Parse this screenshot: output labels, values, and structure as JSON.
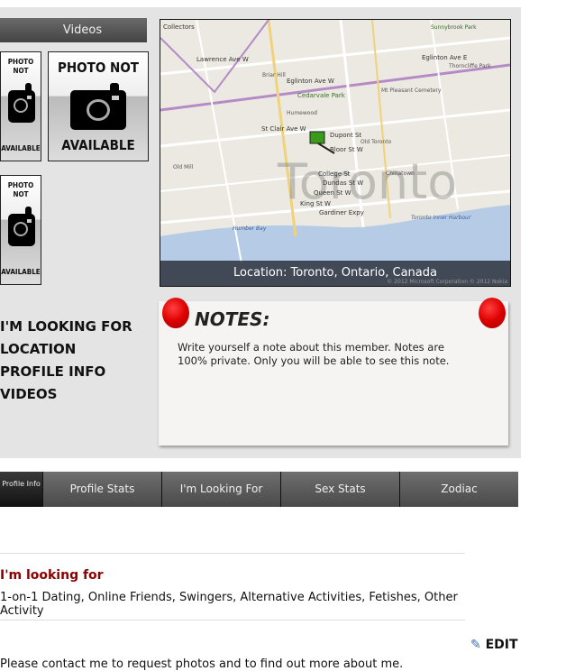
{
  "videos_label": "Videos",
  "photo_tiles": [
    {
      "top": "PHOTO NOT",
      "bottom": "AVAILABLE"
    },
    {
      "top": "PHOTO NOT",
      "bottom": "AVAILABLE"
    },
    {
      "top": "PHOTO NOT",
      "bottom": "AVAILABLE"
    }
  ],
  "side_menu": [
    "I'M LOOKING FOR",
    "LOCATION",
    "PROFILE INFO",
    "VIDEOS"
  ],
  "map": {
    "location": "Location: Toronto, Ontario, Canada",
    "copyright": "© 2012 Microsoft Corporation © 2012 Nokia",
    "city_watermark": "Toronto",
    "labels": [
      "Collectors",
      "Lawrence Ave W",
      "Eglinton Ave W",
      "Eglinton Ave E",
      "Briar Hill",
      "Cedarvale Park",
      "Humewood",
      "St Clair Ave W",
      "Dupont St",
      "Bloor St W",
      "College St",
      "Dundas St W",
      "Queen St W",
      "King St W",
      "Gardiner Expy",
      "Chinatown",
      "Old Toronto",
      "Mt Pleasant Cemetery",
      "Sunnybrook Park",
      "Thorncliffe Park",
      "Toronto Inner Harbour",
      "Humber Bay",
      "Old Mill"
    ]
  },
  "notes": {
    "title": "NOTES:",
    "text": "Write yourself a note about this member. Notes are 100% private. Only you will be able to see this note."
  },
  "tabs": [
    "Profile Info",
    "Profile Stats",
    "I'm Looking For",
    "Sex Stats",
    "Zodiac"
  ],
  "looking_for": {
    "heading": "I'm looking for",
    "value": "1-on-1 Dating, Online Friends, Swingers, Alternative Activities, Fetishes, Other Activity"
  },
  "edit_label": "EDIT",
  "about_text": "Please contact me to request photos and to find out more about me.",
  "colors": {
    "heading": "#8b0000",
    "tab_bar": "#555555",
    "pin": "#dd0000"
  }
}
